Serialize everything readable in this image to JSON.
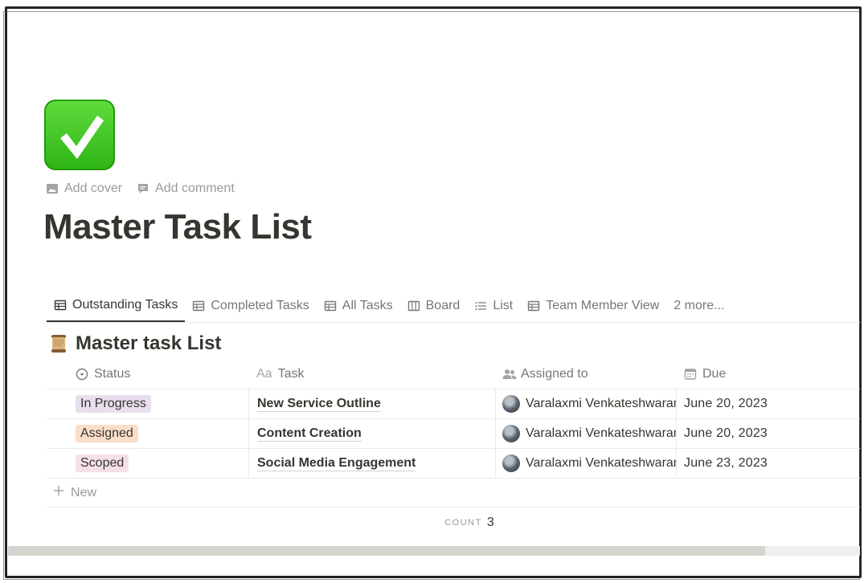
{
  "page": {
    "icon": "check-mark-button-icon",
    "actions": [
      {
        "label": "Add cover",
        "icon": "image-icon"
      },
      {
        "label": "Add comment",
        "icon": "comment-icon"
      }
    ],
    "title": "Master Task List"
  },
  "views": {
    "tabs": [
      {
        "label": "Outstanding Tasks",
        "icon": "table-icon",
        "active": true
      },
      {
        "label": "Completed Tasks",
        "icon": "table-icon",
        "active": false
      },
      {
        "label": "All Tasks",
        "icon": "table-icon",
        "active": false
      },
      {
        "label": "Board",
        "icon": "board-icon",
        "active": false
      },
      {
        "label": "List",
        "icon": "list-icon",
        "active": false
      },
      {
        "label": "Team Member View",
        "icon": "table-icon",
        "active": false
      }
    ],
    "more_label": "2 more..."
  },
  "database": {
    "icon": "scroll-icon",
    "title": "Master task List",
    "columns": {
      "status": {
        "label": "Status",
        "icon": "status-icon"
      },
      "task": {
        "label": "Task",
        "icon_text": "Aa"
      },
      "assigned": {
        "label": "Assigned to",
        "icon": "people-icon"
      },
      "due": {
        "label": "Due",
        "icon": "calendar-icon"
      }
    },
    "rows": [
      {
        "status": "In Progress",
        "status_bg": "#e8deee",
        "task": "New Service Outline",
        "assigned": "Varalaxmi Venkateshwaran",
        "due": "June 20, 2023"
      },
      {
        "status": "Assigned",
        "status_bg": "#fadec9",
        "task": "Content Creation",
        "assigned": "Varalaxmi Venkateshwaran",
        "due": "June 20, 2023"
      },
      {
        "status": "Scoped",
        "status_bg": "#f5e0e9",
        "task": "Social Media Engagement",
        "assigned": "Varalaxmi Venkateshwaran",
        "due": "June 23, 2023"
      }
    ],
    "new_label": "New",
    "count_label": "COUNT",
    "count_value": "3"
  }
}
